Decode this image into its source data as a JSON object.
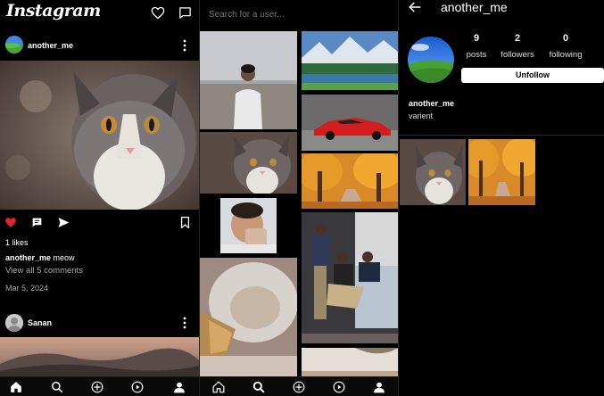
{
  "feed": {
    "logo": "Instagram",
    "post1": {
      "username": "another_me",
      "likes": "1 likes",
      "caption_user": "another_me",
      "caption_text": "meow",
      "view_comments": "View all 5 comments",
      "date": "Mar 5, 2024"
    },
    "post2": {
      "username": "Sanan"
    }
  },
  "search": {
    "placeholder": "Search for a user..."
  },
  "profile": {
    "username": "another_me",
    "stats": [
      {
        "value": "9",
        "label": "posts"
      },
      {
        "value": "2",
        "label": "followers"
      },
      {
        "value": "0",
        "label": "following"
      }
    ],
    "unfollow_label": "Unfollow",
    "bio_name": "another_me",
    "bio_text": "varient"
  },
  "colors": {
    "like_red": "#e0242d",
    "background": "#000000"
  },
  "icons": [
    "heart-icon",
    "message-icon",
    "comment-icon",
    "share-icon",
    "bookmark-icon",
    "more-icon",
    "home-icon",
    "search-icon",
    "add-icon",
    "reels-icon",
    "profile-icon",
    "back-arrow-icon"
  ]
}
